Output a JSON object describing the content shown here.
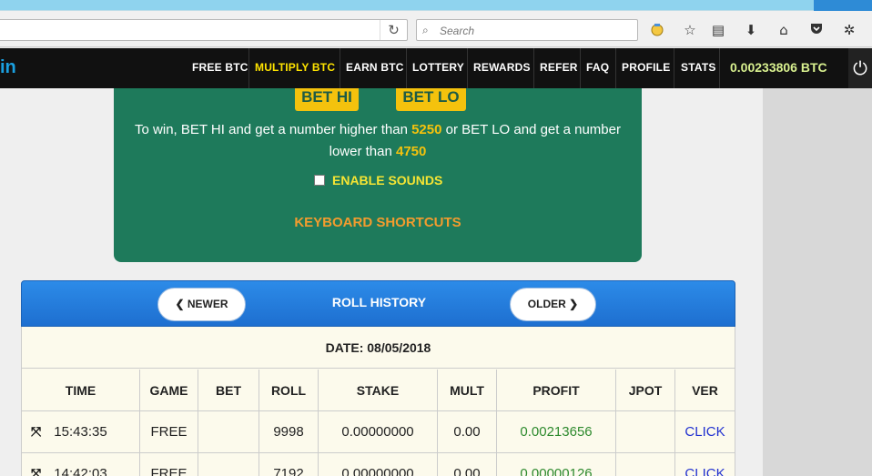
{
  "browser": {
    "search_placeholder": "Search",
    "reload_icon": "reload-icon",
    "icons": [
      "extension-icon",
      "bookmark-star-icon",
      "reader-list-icon",
      "download-icon",
      "home-icon",
      "pocket-icon",
      "settings-extension-icon"
    ]
  },
  "nav": {
    "logo_text": "in",
    "links": [
      "FREE BTC",
      "MULTIPLY BTC",
      "EARN BTC",
      "LOTTERY",
      "REWARDS",
      "REFER",
      "FAQ",
      "PROFILE",
      "STATS"
    ],
    "active": "MULTIPLY BTC",
    "balance": "0.00233806 BTC"
  },
  "game": {
    "bet_hi": "BET HI",
    "bet_lo": "BET LO",
    "win_line1_a": "To win, BET HI and get a number higher than ",
    "hi_number": "5250",
    "win_line1_b": " or BET LO and get a number",
    "win_line2_a": "lower than ",
    "lo_number": "4750",
    "enable_sounds": "ENABLE SOUNDS",
    "keyboard_shortcuts": "KEYBOARD SHORTCUTS"
  },
  "history": {
    "newer": "NEWER",
    "title": "ROLL HISTORY",
    "older": "OLDER",
    "date": "DATE: 08/05/2018",
    "columns": [
      "TIME",
      "GAME",
      "BET",
      "ROLL",
      "STAKE",
      "MULT",
      "PROFIT",
      "JPOT",
      "VER"
    ],
    "rows": [
      {
        "time": "15:43:35",
        "game": "FREE",
        "bet": "",
        "roll": "9998",
        "stake": "0.00000000",
        "mult": "0.00",
        "profit": "0.00213656",
        "jpot": "",
        "ver": "CLICK"
      },
      {
        "time": "14:42:03",
        "game": "FREE",
        "bet": "",
        "roll": "7192",
        "stake": "0.00000000",
        "mult": "0.00",
        "profit": "0.00000126",
        "jpot": "",
        "ver": "CLICK"
      }
    ]
  },
  "colors": {
    "green_panel": "#1e7a5b",
    "bet_button": "#f4c20d",
    "header_blue": "#1e6fd0",
    "balance": "#d8f08f",
    "profit": "#2e8a2e",
    "link": "#2030d0"
  }
}
